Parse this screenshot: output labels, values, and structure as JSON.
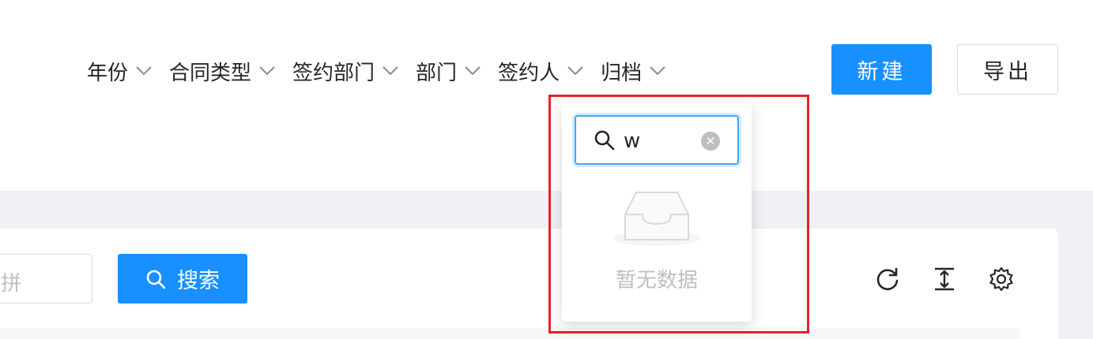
{
  "filters": [
    {
      "label": "年份"
    },
    {
      "label": "合同类型"
    },
    {
      "label": "签约部门"
    },
    {
      "label": "部门"
    },
    {
      "label": "签约人"
    },
    {
      "label": "归档"
    }
  ],
  "actions": {
    "new_label": "新建",
    "export_label": "导出"
  },
  "search": {
    "placeholder_fragment": "拼",
    "button_label": "搜索"
  },
  "toolbar_icons": [
    "refresh-icon",
    "column-height-icon",
    "settings-icon"
  ],
  "dropdown": {
    "search_value": "w",
    "empty_text": "暂无数据"
  },
  "colors": {
    "primary": "#1890ff",
    "highlight": "#e8202a",
    "page_bg": "#f0f1f5"
  }
}
